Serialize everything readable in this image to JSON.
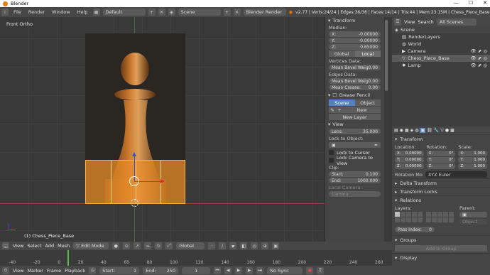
{
  "title": "Blender",
  "menu": [
    "File",
    "Render",
    "Window",
    "Help"
  ],
  "layout": "Default",
  "scene": "Scene",
  "engine": "Blender Render",
  "stats": "v2.77 | Verts:24/24 | Edges:36/36 | Faces:14/14 | Tris:44 | Mem:23.15M | Chess_Piece_Base",
  "viewport": {
    "view_name": "Front Ortho",
    "object_label": "(1) Chess_Piece_Base"
  },
  "npanel": {
    "transform": "Transform",
    "median": "Median:",
    "x": "X:",
    "x_val": "-0.00000",
    "y": "Y:",
    "y_val": "-0.00000",
    "z": "Z:",
    "z_val": "0.65000",
    "global": "Global",
    "local": "Local",
    "vertices_data": "Vertices Data:",
    "mean_bevel_v": "Mean Bevel Weig",
    "mean_bevel_v_val": "0.00",
    "edges_data": "Edges Data:",
    "mean_bevel_e": "Mean Bevel Weig",
    "mean_bevel_e_val": "0.00",
    "mean_crease": "Mean Crease:",
    "mean_crease_val": "0.00",
    "grease": "Grease Pencil",
    "scene": "Scene",
    "object": "Object",
    "new": "New",
    "new_layer": "New Layer",
    "view": "View",
    "lens": "Lens:",
    "lens_val": "35.000",
    "lock_to_object": "Lock to Object:",
    "lock_cursor": "Lock to Cursor",
    "lock_camera": "Lock Camera to View",
    "clip": "Clip:",
    "start": "Start:",
    "start_val": "0.100",
    "end": "End:",
    "end_val": "1000.000",
    "local_camera": "Local Camera:",
    "camera": "Camera"
  },
  "outliner": {
    "view": "View",
    "search": "Search",
    "all_scenes": "All Scenes",
    "items": [
      "Scene",
      "RenderLayers",
      "World",
      "Camera",
      "Chess_Piece_Base",
      "Lamp"
    ]
  },
  "props": {
    "transform": "Transform",
    "location": "Location:",
    "rotation": "Rotation:",
    "scale": "Scale:",
    "loc": [
      "0.00000",
      "0.00000",
      "0.00000"
    ],
    "rot": [
      "0°",
      "0°",
      "0°"
    ],
    "scl": [
      "1.000",
      "1.000",
      "1.000"
    ],
    "axes": [
      "X:",
      "Y:",
      "Z:"
    ],
    "rotation_mode": "Rotation Mo",
    "rotation_mode_val": "XYZ Euler",
    "delta": "Delta Transform",
    "locks": "Transform Locks",
    "relations": "Relations",
    "layers": "Layers:",
    "parent": "Parent:",
    "object": "Object",
    "pass_index": "Pass Index:",
    "pass_index_val": "0",
    "groups": "Groups",
    "add_to_group": "Add to Group",
    "display": "Display"
  },
  "bottombar": {
    "view": "View",
    "select": "Select",
    "add": "Add",
    "mesh": "Mesh",
    "mode": "Edit Mode",
    "pivot": "Global"
  },
  "timeline": {
    "ticks": [
      "-40",
      "-20",
      "0",
      "20",
      "40",
      "60",
      "80",
      "100",
      "120",
      "140",
      "160",
      "180",
      "200",
      "220",
      "240",
      "260"
    ]
  },
  "tlctrl": {
    "view": "View",
    "marker": "Marker",
    "frame": "Frame",
    "playback": "Playback",
    "start": "Start:",
    "start_val": "1",
    "end": "End:",
    "end_val": "250",
    "current": "1",
    "sync": "No Sync"
  },
  "colors": {
    "accent": "#5680c2",
    "orange": "#e89a2c",
    "header": "#474747"
  }
}
